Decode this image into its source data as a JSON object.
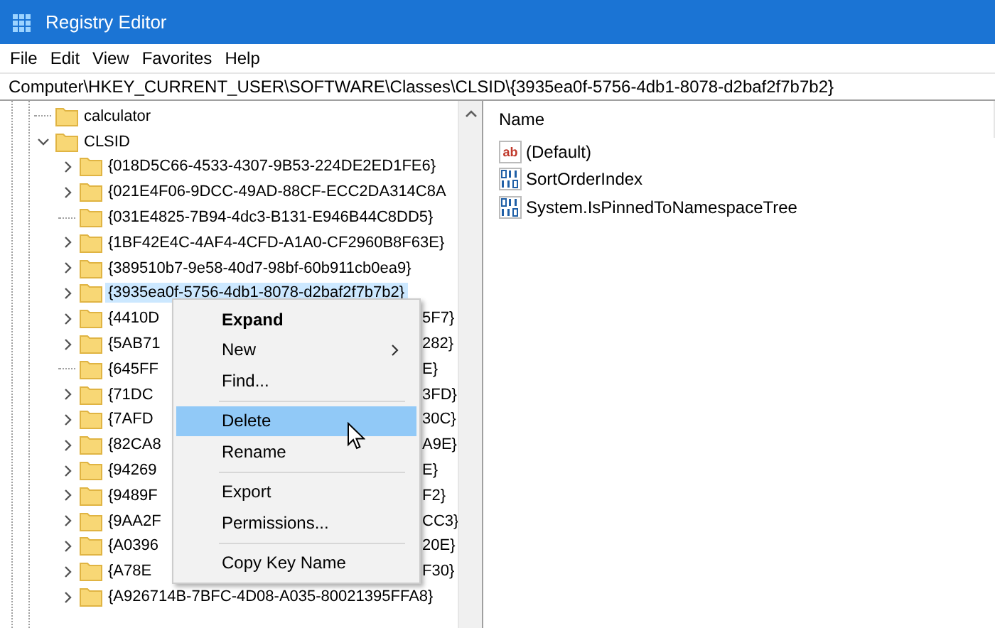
{
  "window": {
    "title": "Registry Editor"
  },
  "menu_bar": [
    "File",
    "Edit",
    "View",
    "Favorites",
    "Help"
  ],
  "address": "Computer\\HKEY_CURRENT_USER\\SOFTWARE\\Classes\\CLSID\\{3935ea0f-5756-4db1-8078-d2baf2f7b7b2}",
  "tree": [
    {
      "label": "calculator",
      "kind": "leaf",
      "selected": false
    },
    {
      "label": "CLSID",
      "kind": "branch",
      "expanded": true,
      "selected": false,
      "children": [
        {
          "label": "{018D5C66-4533-4307-9B53-224DE2ED1FE6}",
          "kind": "branch",
          "expanded": false,
          "selected": false
        },
        {
          "label": "{021E4F06-9DCC-49AD-88CF-ECC2DA314C8A",
          "kind": "branch",
          "expanded": false,
          "selected": false
        },
        {
          "label": "{031E4825-7B94-4dc3-B131-E946B44C8DD5}",
          "kind": "leaf",
          "selected": false
        },
        {
          "label": "{1BF42E4C-4AF4-4CFD-A1A0-CF2960B8F63E}",
          "kind": "branch",
          "expanded": false,
          "selected": false
        },
        {
          "label": "{389510b7-9e58-40d7-98bf-60b911cb0ea9}",
          "kind": "branch",
          "expanded": false,
          "selected": false
        },
        {
          "label": "{3935ea0f-5756-4db1-8078-d2baf2f7b7b2}",
          "kind": "branch",
          "expanded": false,
          "selected": true
        },
        {
          "label": "{4410D",
          "tail": "5F7}",
          "kind": "branch",
          "expanded": false,
          "selected": false
        },
        {
          "label": "{5AB71",
          "tail": "282}",
          "kind": "branch",
          "expanded": false,
          "selected": false
        },
        {
          "label": "{645FF",
          "tail": "E}",
          "kind": "leaf",
          "selected": false
        },
        {
          "label": "{71DC",
          "tail": "3FD}",
          "kind": "branch",
          "expanded": false,
          "selected": false
        },
        {
          "label": "{7AFD",
          "tail": "30C}",
          "kind": "branch",
          "expanded": false,
          "selected": false
        },
        {
          "label": "{82CA8",
          "tail": "A9E}",
          "kind": "branch",
          "expanded": false,
          "selected": false
        },
        {
          "label": "{94269",
          "tail": "E}",
          "kind": "branch",
          "expanded": false,
          "selected": false
        },
        {
          "label": "{9489F",
          "tail": "F2}",
          "kind": "branch",
          "expanded": false,
          "selected": false
        },
        {
          "label": "{9AA2F",
          "tail": "CC3}",
          "kind": "branch",
          "expanded": false,
          "selected": false
        },
        {
          "label": "{A0396",
          "tail": "20E}",
          "kind": "branch",
          "expanded": false,
          "selected": false
        },
        {
          "label": "{A78E",
          "tail": "F30}",
          "kind": "branch",
          "expanded": false,
          "selected": false
        },
        {
          "label": "{A926714B-7BFC-4D08-A035-80021395FFA8}",
          "kind": "branch",
          "expanded": false,
          "selected": false
        }
      ]
    }
  ],
  "values": {
    "columns": [
      "Name"
    ],
    "rows": [
      {
        "name": "(Default)",
        "kind": "string",
        "icon_label": "ab"
      },
      {
        "name": "SortOrderIndex",
        "kind": "binary"
      },
      {
        "name": "System.IsPinnedToNamespaceTree",
        "kind": "binary"
      }
    ]
  },
  "context_menu": [
    {
      "label": "Expand",
      "kind": "item",
      "bold": true,
      "submenu": false,
      "selected": false
    },
    {
      "label": "New",
      "kind": "item",
      "bold": false,
      "submenu": true,
      "selected": false
    },
    {
      "label": "Find...",
      "kind": "item",
      "bold": false,
      "submenu": false,
      "selected": false
    },
    {
      "kind": "separator"
    },
    {
      "label": "Delete",
      "kind": "item",
      "bold": false,
      "submenu": false,
      "selected": true
    },
    {
      "label": "Rename",
      "kind": "item",
      "bold": false,
      "submenu": false,
      "selected": false
    },
    {
      "kind": "separator"
    },
    {
      "label": "Export",
      "kind": "item",
      "bold": false,
      "submenu": false,
      "selected": false
    },
    {
      "label": "Permissions...",
      "kind": "item",
      "bold": false,
      "submenu": false,
      "selected": false
    },
    {
      "kind": "separator"
    },
    {
      "label": "Copy Key Name",
      "kind": "item",
      "bold": false,
      "submenu": false,
      "selected": false
    }
  ]
}
